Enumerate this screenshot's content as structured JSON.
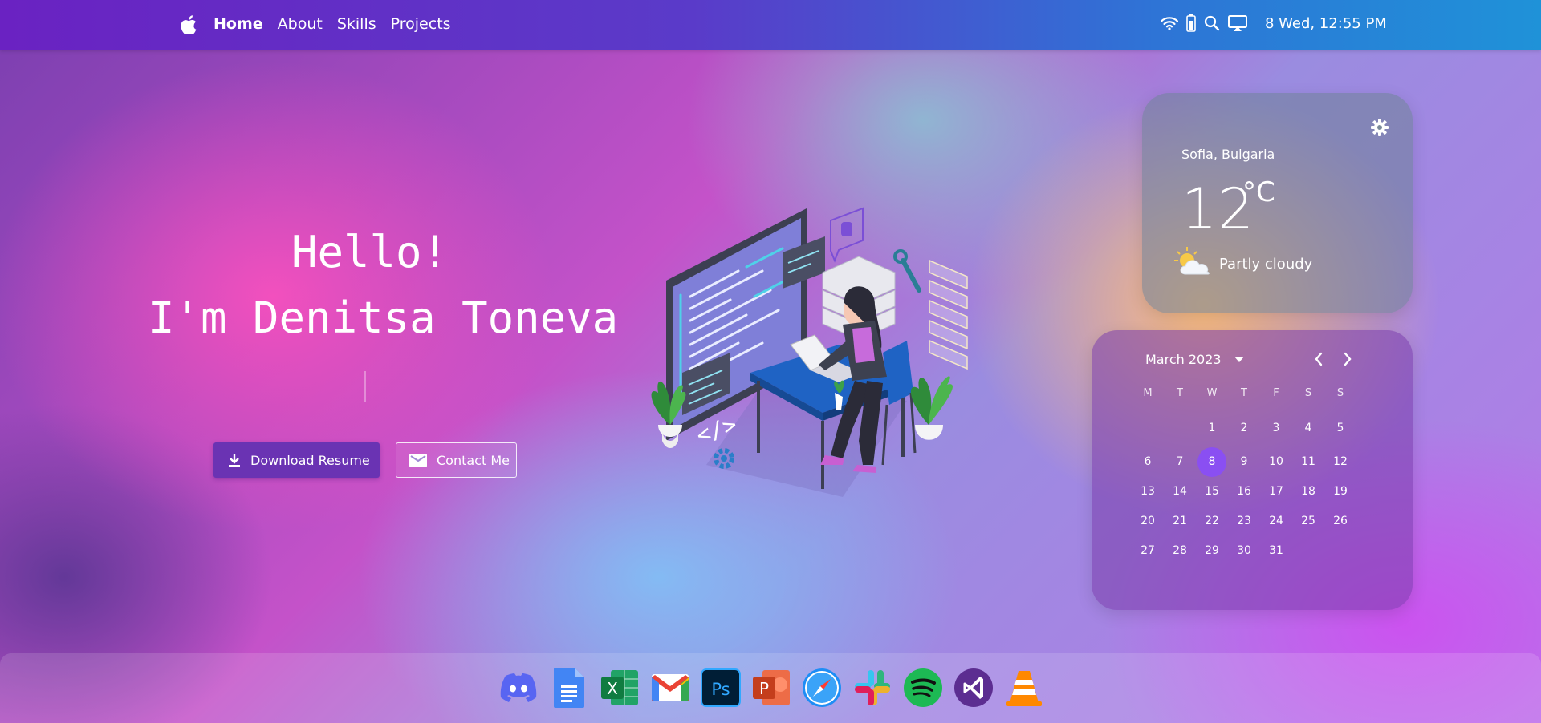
{
  "topbar": {
    "logo_icon": "apple-icon",
    "nav": [
      "Home",
      "About",
      "Skills",
      "Projects"
    ],
    "active_nav": "Home",
    "status_icons": [
      "wifi-icon",
      "battery-icon",
      "search-icon",
      "airplay-icon"
    ],
    "clock": "8 Wed, 12:55 PM"
  },
  "hero": {
    "greeting": "Hello!",
    "name": "I'm Denitsa Toneva",
    "download_label": "Download Resume",
    "contact_label": "Contact Me"
  },
  "weather": {
    "location": "Sofia, Bulgaria",
    "temperature": "12",
    "unit": "°C",
    "condition": "Partly cloudy"
  },
  "calendar": {
    "month_label": "March 2023",
    "weekdays": [
      "M",
      "T",
      "W",
      "T",
      "F",
      "S",
      "S"
    ],
    "weeks": [
      [
        "",
        "",
        "1",
        "2",
        "3",
        "4",
        "5"
      ],
      [
        "6",
        "7",
        "8",
        "9",
        "10",
        "11",
        "12"
      ],
      [
        "13",
        "14",
        "15",
        "16",
        "17",
        "18",
        "19"
      ],
      [
        "20",
        "21",
        "22",
        "23",
        "24",
        "25",
        "26"
      ],
      [
        "27",
        "28",
        "29",
        "30",
        "31",
        "",
        ""
      ]
    ],
    "today": "8"
  },
  "dock": {
    "apps": [
      "discord-icon",
      "google-docs-icon",
      "excel-icon",
      "gmail-icon",
      "photoshop-icon",
      "powerpoint-icon",
      "safari-icon",
      "slack-icon",
      "spotify-icon",
      "visual-studio-icon",
      "vlc-icon"
    ]
  },
  "colors": {
    "topbar_start": "#6a22c2",
    "topbar_end": "#1f92d8",
    "primary_button": "#6a33b3",
    "today_highlight": "#8a4ff2"
  }
}
